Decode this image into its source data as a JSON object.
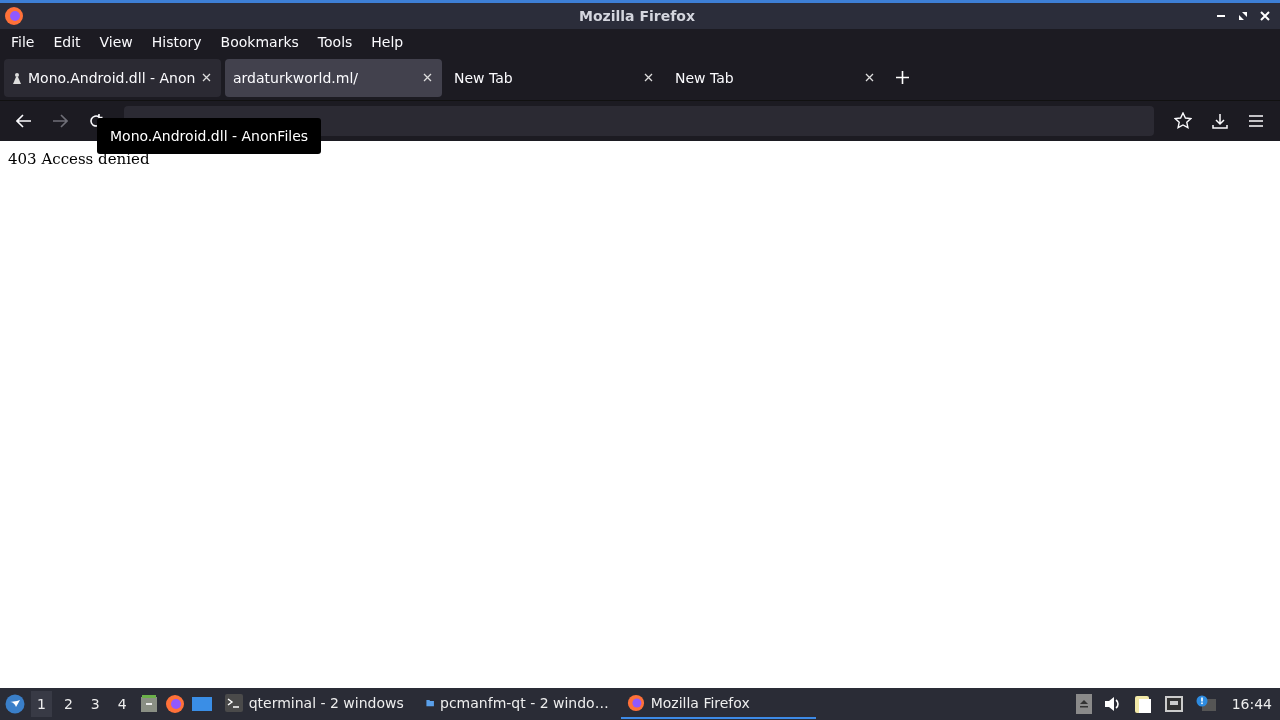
{
  "window": {
    "title": "Mozilla Firefox"
  },
  "menu": [
    {
      "label": "File"
    },
    {
      "label": "Edit"
    },
    {
      "label": "View"
    },
    {
      "label": "History"
    },
    {
      "label": "Bookmarks"
    },
    {
      "label": "Tools"
    },
    {
      "label": "Help"
    }
  ],
  "tabs": [
    {
      "title": "Mono.Android.dll - Anon",
      "selected": false,
      "kind": "favicon"
    },
    {
      "title": "ardaturkworld.ml/",
      "selected": true,
      "kind": "plain"
    },
    {
      "title": "New Tab",
      "selected": false,
      "kind": "plain"
    },
    {
      "title": "New Tab",
      "selected": false,
      "kind": "plain"
    }
  ],
  "tooltip": "Mono.Android.dll - AnonFiles",
  "page": {
    "text": "403 Access denied"
  },
  "taskbar": {
    "workspaces": [
      {
        "label": "1",
        "selected": true
      },
      {
        "label": "2",
        "selected": false
      },
      {
        "label": "3",
        "selected": false
      },
      {
        "label": "4",
        "selected": false
      }
    ],
    "tasks": [
      {
        "label": "qterminal - 2 windows",
        "kind": "terminal",
        "selected": false
      },
      {
        "label": "pcmanfm-qt - 2 windo…",
        "kind": "folder",
        "selected": false
      },
      {
        "label": "Mozilla Firefox",
        "kind": "firefox",
        "selected": true
      }
    ],
    "clock": "16:44"
  }
}
